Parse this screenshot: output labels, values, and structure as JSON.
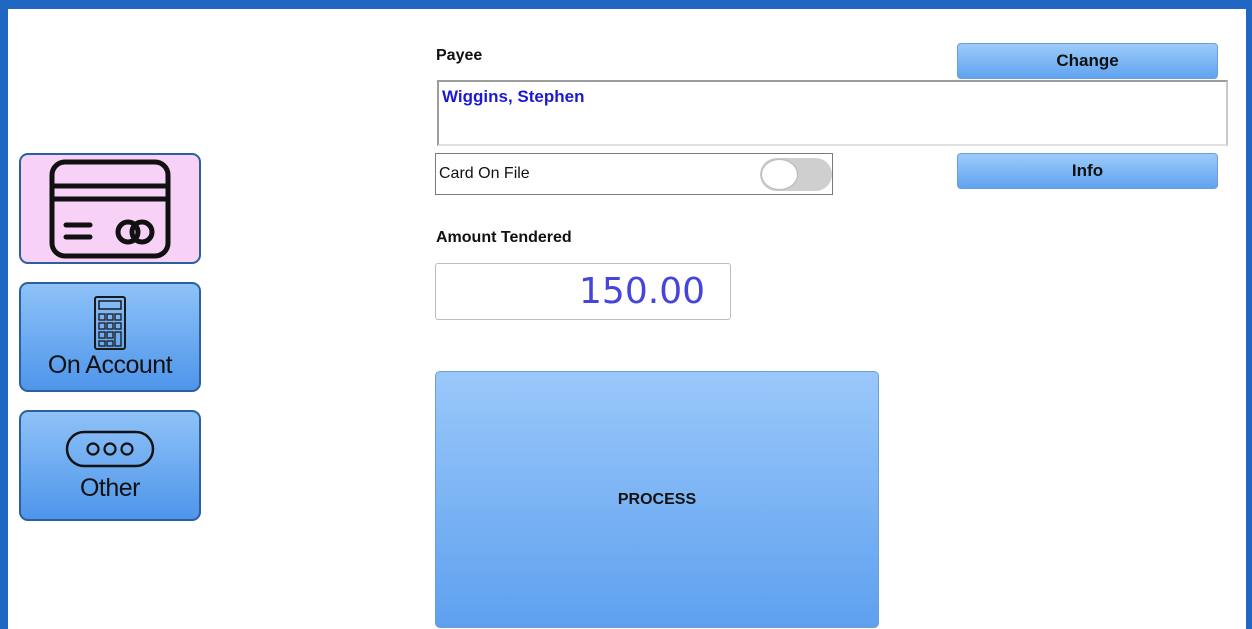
{
  "tenders": {
    "card": {
      "icon": "credit-card-icon",
      "background": "#f8d2f6"
    },
    "account": {
      "label": "On Account",
      "icon": "calculator-icon"
    },
    "other": {
      "label": "Other",
      "icon": "more-dots-icon"
    }
  },
  "payee": {
    "label": "Payee",
    "name": "Wiggins, Stephen",
    "change_label": "Change",
    "info_label": "Info"
  },
  "card_on_file": {
    "label": "Card On File",
    "toggle_on": false
  },
  "amount": {
    "label": "Amount Tendered",
    "value": "150.00"
  },
  "process_label": "PROCESS",
  "colors": {
    "frame": "#1f67c3",
    "button_blue": "#5fa3ef",
    "payee_text": "#1a1ad6",
    "amount_text": "#4545dd"
  }
}
